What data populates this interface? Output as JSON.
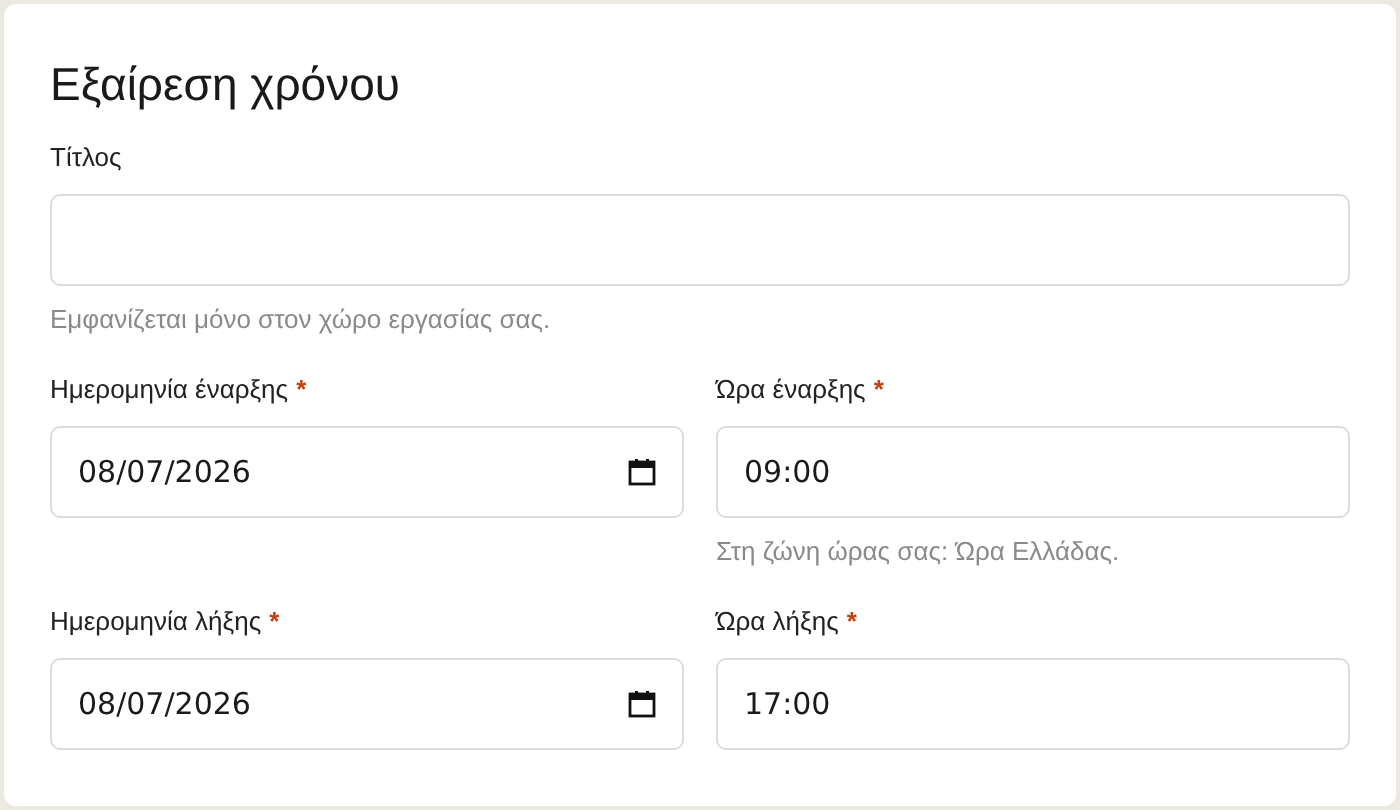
{
  "title": "Εξαίρεση χρόνου",
  "rows": [
    [
      {
        "kind": "text",
        "label": "Τίτλος",
        "hint": "Εμφανίζεται μόνο στον χώρο εργασίας σας."
      }
    ],
    [
      {
        "kind": "date",
        "label": "Ημερομηνία έναρξης",
        "required_mark": "*",
        "value": "08/07/2026"
      },
      {
        "kind": "time",
        "label": "Ώρα έναρξης",
        "required_mark": "*",
        "value": "09:00",
        "hint": "Στη ζώνη ώρας σας: Ώρα Ελλάδας."
      }
    ],
    [
      {
        "kind": "date",
        "label": "Ημερομηνία λήξης",
        "required_mark": "*",
        "value": "08/07/2026"
      },
      {
        "kind": "time",
        "label": "Ώρα λήξης",
        "required_mark": "*",
        "value": "17:00"
      }
    ]
  ]
}
